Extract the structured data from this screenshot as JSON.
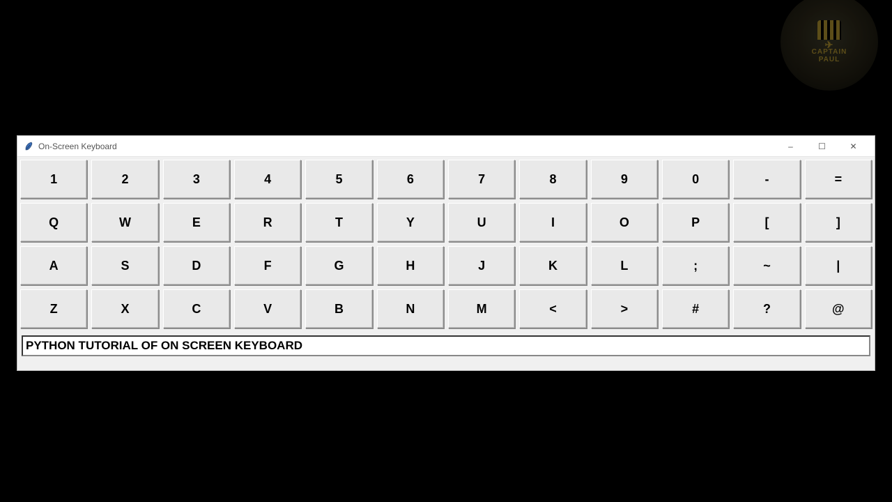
{
  "watermark": {
    "line1": "CAPTAIN",
    "line2": "PAUL"
  },
  "window": {
    "title": "On-Screen Keyboard",
    "minimize": "–",
    "maximize": "☐",
    "close": "✕"
  },
  "keyboard": {
    "rows": [
      [
        "1",
        "2",
        "3",
        "4",
        "5",
        "6",
        "7",
        "8",
        "9",
        "0",
        "-",
        "="
      ],
      [
        "Q",
        "W",
        "E",
        "R",
        "T",
        "Y",
        "U",
        "I",
        "O",
        "P",
        "[",
        "]"
      ],
      [
        "A",
        "S",
        "D",
        "F",
        "G",
        "H",
        "J",
        "K",
        "L",
        ";",
        "~",
        "|"
      ],
      [
        "Z",
        "X",
        "C",
        "V",
        "B",
        "N",
        "M",
        "<",
        ">",
        "#",
        "?",
        "@"
      ]
    ]
  },
  "entry": {
    "value": "PYTHON TUTORIAL OF ON SCREEN KEYBOARD"
  }
}
